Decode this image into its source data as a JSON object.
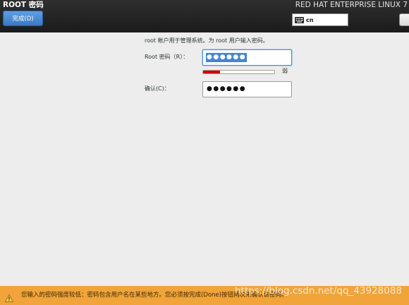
{
  "header": {
    "title": "ROOT 密码",
    "done_label": "完成(D)",
    "product_title": "RED HAT ENTERPRISE LINUX 7",
    "keyboard_layout": "cn",
    "keyboard_icon": "keyboard-icon"
  },
  "form": {
    "intro": "root 帐户用于管理系统。为 root 用户输入密码。",
    "password_label": "Root 密码（R）：",
    "password_value": "●●●●●●",
    "strength_label": "弱",
    "strength_level": 0.24,
    "confirm_label": "确认(C)：",
    "confirm_value": "●●●●●●"
  },
  "warning": {
    "icon": "warning-icon",
    "message": "您输入的密码强度较低：密码包含用户名在某些地方。您必须按完成(Done)按钮两次来确认该密码。"
  },
  "watermark": "https://blog.csdn.net/qq_43928088",
  "colors": {
    "accent": "#4a90d9",
    "strength_fill": "#cc0000",
    "warning_bar": "#f0a43a"
  }
}
